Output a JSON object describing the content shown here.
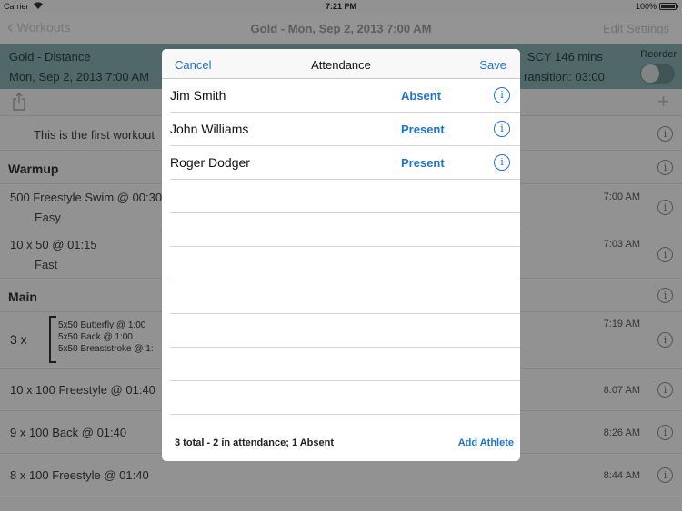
{
  "status_bar": {
    "carrier": "Carrier",
    "time": "7:21 PM",
    "battery": "100%",
    "battery_level": 1.0
  },
  "nav": {
    "back_label": "Workouts",
    "title": "Gold - Mon, Sep 2, 2013 7:00 AM",
    "right_label": "Edit Settings"
  },
  "header": {
    "line1": "Gold - Distance",
    "line2": "Mon, Sep 2, 2013 7:00 AM",
    "line3": "SCY 146 mins",
    "line4": "ransition: 03:00",
    "reorder_label": "Reorder",
    "reorder_on": false
  },
  "workout": {
    "note": "This is the first workout",
    "warmup_header": "Warmup",
    "item1": "500 Freestyle Swim @ 00:30",
    "item1_time": "7:00 AM",
    "item1_sub": "Easy",
    "item2": "10 x 50 @ 01:15",
    "item2_time": "7:03 AM",
    "item2_sub": "Fast",
    "main_header": "Main",
    "set_multiplier": "3 x",
    "set_lines": [
      "5x50 Butterfly @ 1:00",
      "5x50 Back @ 1:00",
      "5x50 Breaststroke @ 1:"
    ],
    "set_time": "7:19 AM",
    "item3": "10 x 100 Freestyle @ 01:40",
    "item3_time": "8:07 AM",
    "item4": "9 x 100 Back @ 01:40",
    "item4_time": "8:26 AM",
    "item5": "8 x 100 Freestyle @ 01:40",
    "item5_time": "8:44 AM"
  },
  "modal": {
    "cancel_label": "Cancel",
    "title": "Attendance",
    "save_label": "Save",
    "athletes": [
      {
        "name": "Jim Smith",
        "status": "Absent"
      },
      {
        "name": "John Williams",
        "status": "Present"
      },
      {
        "name": "Roger Dodger",
        "status": "Present"
      }
    ],
    "summary": "3 total - 2 in attendance; 1 Absent",
    "add_athlete_label": "Add Athlete"
  },
  "icons": {
    "info_glyph": "i",
    "plus_glyph": "+",
    "back_glyph": "‹"
  },
  "colors": {
    "accent": "#1a74d6",
    "teal_header": "#85aeb0"
  }
}
